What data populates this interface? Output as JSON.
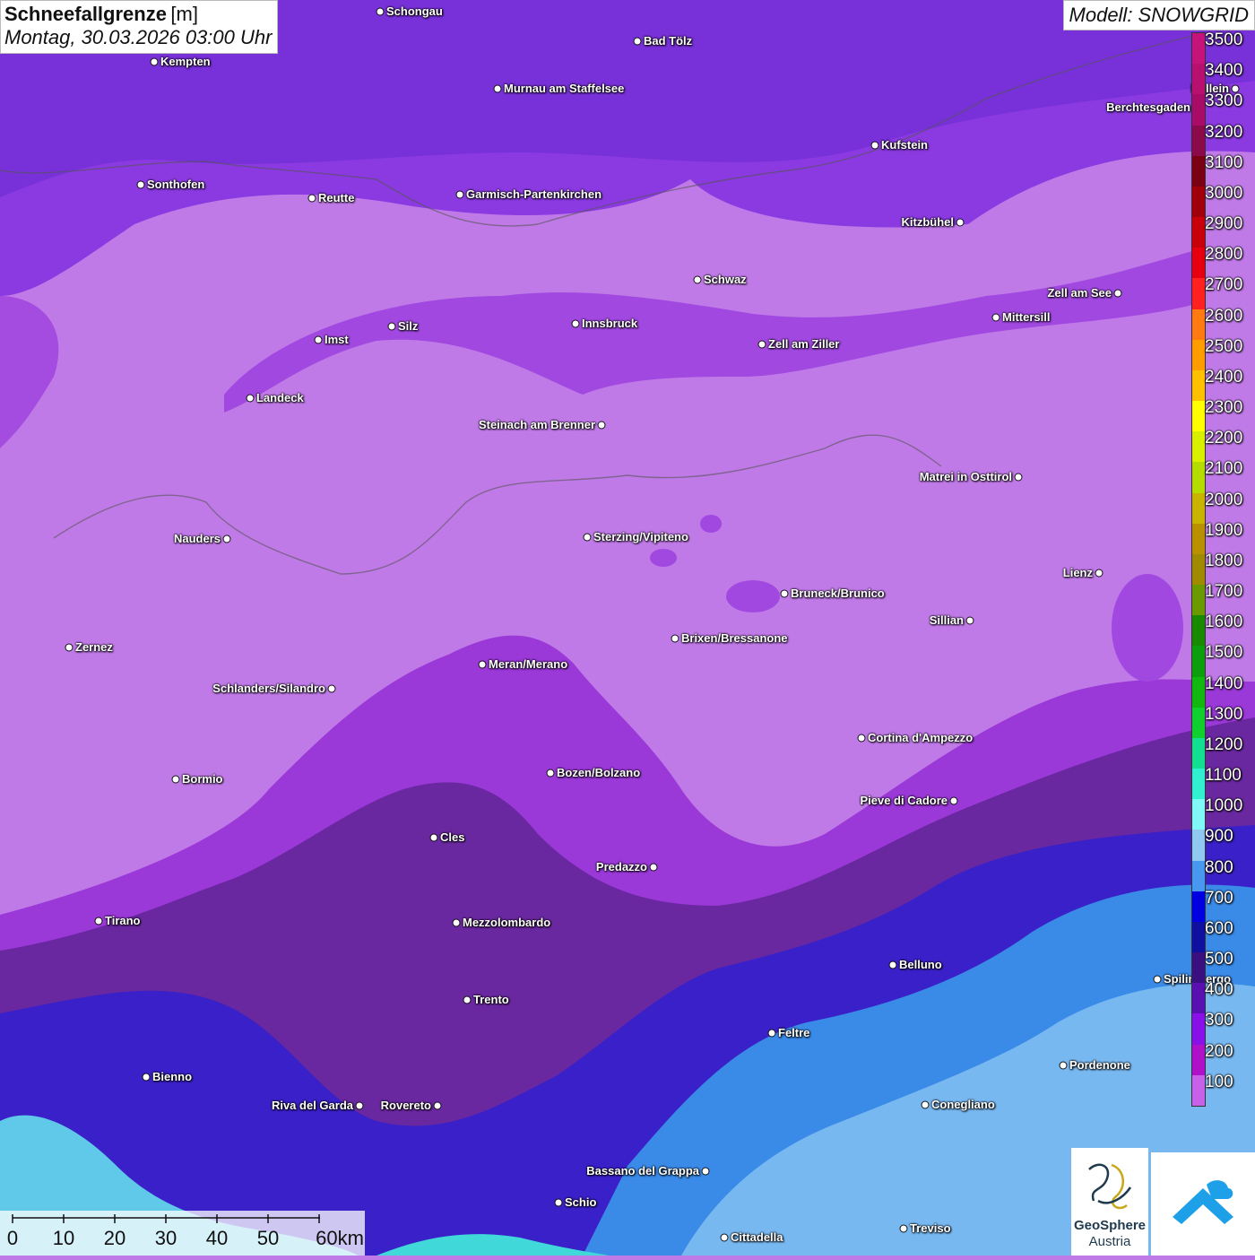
{
  "title": {
    "main": "Schneefallgrenze",
    "unit": "[m]",
    "datetime": "Montag, 30.03.2026 03:00 Uhr"
  },
  "model_label": "Modell: SNOWGRID",
  "legend": {
    "unit": "m",
    "values": [
      3500,
      3400,
      3300,
      3200,
      3100,
      3000,
      2900,
      2800,
      2700,
      2600,
      2500,
      2400,
      2300,
      2200,
      2100,
      2000,
      1900,
      1800,
      1700,
      1600,
      1500,
      1400,
      1300,
      1200,
      1100,
      1000,
      900,
      800,
      700,
      600,
      500,
      400,
      300,
      200,
      100
    ],
    "colors": [
      "#c4147a",
      "#b8106e",
      "#a80c66",
      "#8a0a4a",
      "#7a0014",
      "#a0000a",
      "#c8000a",
      "#e6000f",
      "#ff2020",
      "#ff7a10",
      "#ff9d00",
      "#ffc000",
      "#ffff00",
      "#d8f000",
      "#b4dc00",
      "#c8b400",
      "#b89000",
      "#a08a00",
      "#6a9a00",
      "#188a00",
      "#0c9e0c",
      "#10b810",
      "#10d030",
      "#10e090",
      "#30f0d0",
      "#80f8f8",
      "#90c8f0",
      "#4898f0",
      "#0000e0",
      "#1010a0",
      "#3a1080",
      "#5a10b0",
      "#8a10e8",
      "#b010c8",
      "#c860e8"
    ]
  },
  "map_colors": {
    "above_2000": "#c07ae8",
    "band_1500": "#a44ce0",
    "band_1000": "#9a38d8",
    "band_700": "#6a28a0",
    "band_500": "#3a20c8",
    "band_300": "#3a8ae8",
    "band_lowland": "#78b8f0",
    "band_cyan": "#40e0e0"
  },
  "cities": [
    {
      "name": "Schongau",
      "label_side": "right"
    },
    {
      "name": "Bad Tölz",
      "label_side": "right"
    },
    {
      "name": "Kempten",
      "label_side": "right"
    },
    {
      "name": "Murnau am Staffelsee",
      "label_side": "right"
    },
    {
      "name": "Berchtesgaden",
      "label_side": "left"
    },
    {
      "name": "Hallein",
      "label_side": "left"
    },
    {
      "name": "Kufstein",
      "label_side": "right"
    },
    {
      "name": "Sonthofen",
      "label_side": "right"
    },
    {
      "name": "Reutte",
      "label_side": "right"
    },
    {
      "name": "Garmisch-Partenkirchen",
      "label_side": "right"
    },
    {
      "name": "Kitzbühel",
      "label_side": "left"
    },
    {
      "name": "Schwaz",
      "label_side": "right"
    },
    {
      "name": "Zell am See",
      "label_side": "left"
    },
    {
      "name": "Innsbruck",
      "label_side": "right"
    },
    {
      "name": "Mittersill",
      "label_side": "right"
    },
    {
      "name": "Imst",
      "label_side": "right"
    },
    {
      "name": "Silz",
      "label_side": "right"
    },
    {
      "name": "Zell am Ziller",
      "label_side": "right"
    },
    {
      "name": "Landeck",
      "label_side": "right"
    },
    {
      "name": "Steinach am Brenner",
      "label_side": "left"
    },
    {
      "name": "Matrei in Osttirol",
      "label_side": "left"
    },
    {
      "name": "Nauders",
      "label_side": "left"
    },
    {
      "name": "Sterzing/Vipiteno",
      "label_side": "right"
    },
    {
      "name": "Lienz",
      "label_side": "left"
    },
    {
      "name": "Bruneck/Brunico",
      "label_side": "right"
    },
    {
      "name": "Sillian",
      "label_side": "left"
    },
    {
      "name": "Zernez",
      "label_side": "right"
    },
    {
      "name": "Brixen/Bressanone",
      "label_side": "right"
    },
    {
      "name": "Meran/Merano",
      "label_side": "right"
    },
    {
      "name": "Schlanders/Silandro",
      "label_side": "left"
    },
    {
      "name": "Cortina d'Ampezzo",
      "label_side": "right"
    },
    {
      "name": "Bozen/Bolzano",
      "label_side": "right"
    },
    {
      "name": "Bormio",
      "label_side": "right"
    },
    {
      "name": "Pieve di Cadore",
      "label_side": "left"
    },
    {
      "name": "Cles",
      "label_side": "right"
    },
    {
      "name": "Predazzo",
      "label_side": "left"
    },
    {
      "name": "Tirano",
      "label_side": "right"
    },
    {
      "name": "Mezzolombardo",
      "label_side": "right"
    },
    {
      "name": "Belluno",
      "label_side": "right"
    },
    {
      "name": "Spilimbergo",
      "label_side": "right"
    },
    {
      "name": "Trento",
      "label_side": "right"
    },
    {
      "name": "Feltre",
      "label_side": "right"
    },
    {
      "name": "Pordenone",
      "label_side": "right"
    },
    {
      "name": "Bienno",
      "label_side": "right"
    },
    {
      "name": "Riva del Garda",
      "label_side": "left"
    },
    {
      "name": "Rovereto",
      "label_side": "left"
    },
    {
      "name": "Conegliano",
      "label_side": "right"
    },
    {
      "name": "Bassano del Grappa",
      "label_side": "left"
    },
    {
      "name": "Schio",
      "label_side": "right"
    },
    {
      "name": "Treviso",
      "label_side": "right"
    },
    {
      "name": "Cittadella",
      "label_side": "right"
    }
  ],
  "scale_bar": {
    "labels": [
      "0",
      "10",
      "20",
      "30",
      "40",
      "50",
      "60km"
    ]
  },
  "logos": {
    "geosphere_line1": "GeoSphere",
    "geosphere_line2": "Austria"
  }
}
